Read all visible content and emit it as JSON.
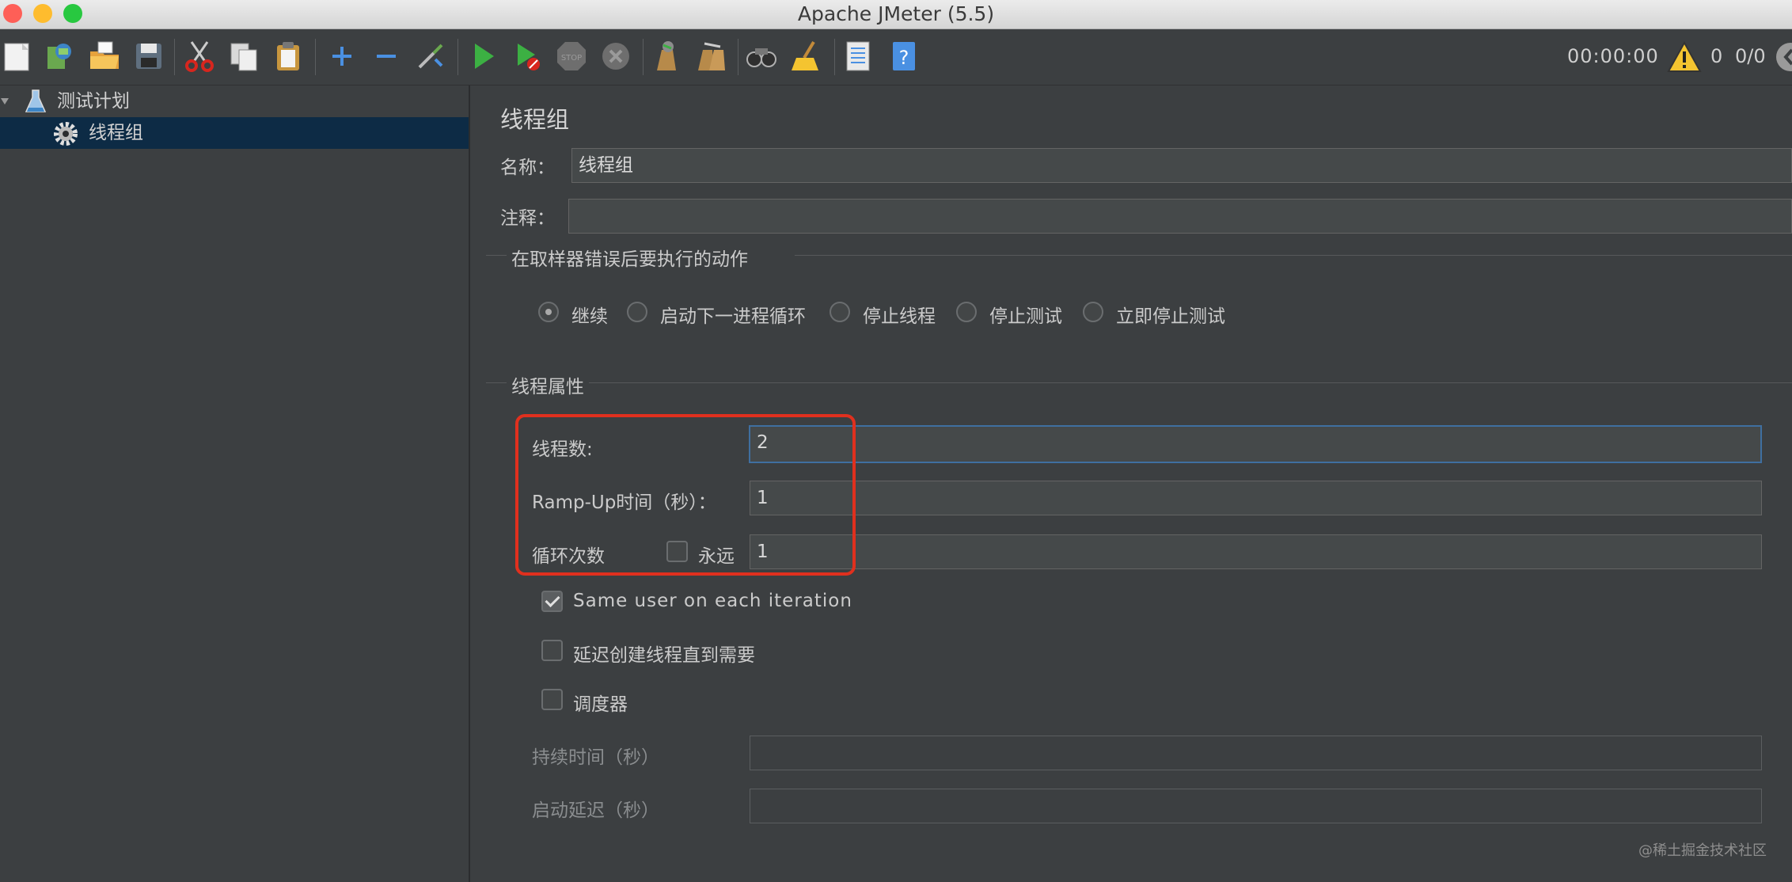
{
  "window": {
    "title": "Apache JMeter (5.5)",
    "traffic_lights": [
      "#fe5f57",
      "#febc2e",
      "#28c840"
    ]
  },
  "toolbar": {
    "buttons": [
      "new-icon",
      "templates-icon",
      "open-icon",
      "save-icon",
      "cut-icon",
      "copy-icon",
      "paste-icon",
      "expand-icon",
      "collapse-icon",
      "toggle-icon",
      "start-icon",
      "start-no-pause-icon",
      "stop-icon",
      "shutdown-icon",
      "clear-icon",
      "clear-all-icon",
      "search-icon",
      "reset-search-icon",
      "function-helper-icon",
      "help-icon"
    ],
    "timer": "00:00:00",
    "warning_count": "0",
    "thread_count": "0/0"
  },
  "tree": {
    "root": "测试计划",
    "child": "线程组"
  },
  "panel": {
    "title": "线程组",
    "name_label": "名称：",
    "name_value": "线程组",
    "comment_label": "注释：",
    "comment_value": "",
    "error_section": "在取样器错误后要执行的动作",
    "error_options": [
      "继续",
      "启动下一进程循环",
      "停止线程",
      "停止测试",
      "立即停止测试"
    ],
    "error_selected": "继续",
    "props_section": "线程属性",
    "threads_label": "线程数:",
    "threads_value": "2",
    "rampup_label": "Ramp-Up时间（秒）：",
    "rampup_value": "1",
    "loop_label": "循环次数",
    "forever_label": "永远",
    "forever_checked": false,
    "loop_value": "1",
    "same_user_label": "Same user on each iteration",
    "same_user_checked": true,
    "delay_label": "延迟创建线程直到需要",
    "delay_checked": false,
    "scheduler_label": "调度器",
    "scheduler_checked": false,
    "duration_label": "持续时间（秒）",
    "duration_value": "",
    "startup_delay_label": "启动延迟（秒）",
    "startup_delay_value": ""
  },
  "watermark": "@稀土掘金技术社区",
  "colors": {
    "background": "#3c3f41",
    "selection": "#0d2b45",
    "highlight_box": "#e0301e",
    "focus_border": "#3f6fa0"
  }
}
